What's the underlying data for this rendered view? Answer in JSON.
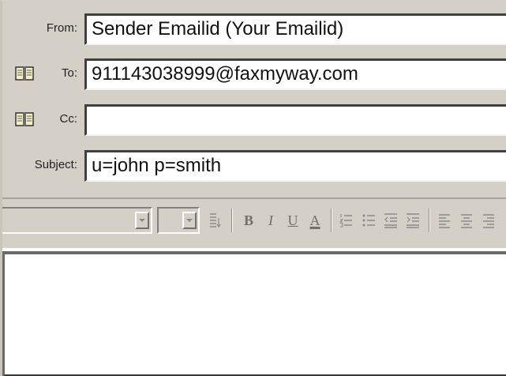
{
  "compose": {
    "from": {
      "label": "From:",
      "value": "Sender Emailid (Your Emailid)"
    },
    "to": {
      "label": "To:",
      "value": "911143038999@faxmyway.com",
      "icon": "address-book-icon"
    },
    "cc": {
      "label": "Cc:",
      "value": "",
      "icon": "address-book-icon"
    },
    "subject": {
      "label": "Subject:",
      "value": "u=john p=smith"
    }
  },
  "toolbar": {
    "font_name": "",
    "font_size": "",
    "bold_glyph": "B",
    "italic_glyph": "I",
    "underline_glyph": "U",
    "color_glyph": "A"
  },
  "message": {
    "body": ""
  }
}
